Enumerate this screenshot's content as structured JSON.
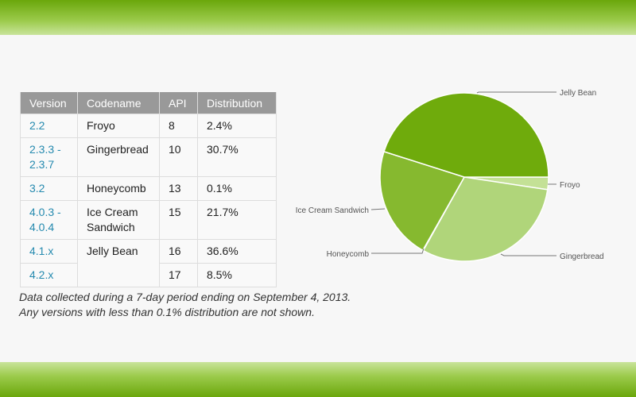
{
  "table": {
    "headers": [
      "Version",
      "Codename",
      "API",
      "Distribution"
    ],
    "rows": [
      {
        "version": "2.2",
        "codename": "Froyo",
        "api": "8",
        "distribution": "2.4%"
      },
      {
        "version": "2.3.3 - 2.3.7",
        "codename": "Gingerbread",
        "api": "10",
        "distribution": "30.7%"
      },
      {
        "version": "3.2",
        "codename": "Honeycomb",
        "api": "13",
        "distribution": "0.1%"
      },
      {
        "version": "4.0.3 - 4.0.4",
        "codename": "Ice Cream Sandwich",
        "api": "15",
        "distribution": "21.7%"
      },
      {
        "version": "4.1.x",
        "codename": "Jelly Bean",
        "api": "16",
        "distribution": "36.6%"
      },
      {
        "version": "4.2.x",
        "codename": "",
        "api": "17",
        "distribution": "8.5%"
      }
    ]
  },
  "caption": {
    "line1": "Data collected during a 7-day period ending on September 4, 2013.",
    "line2": "Any versions with less than 0.1% distribution are not shown."
  },
  "chart_data": {
    "type": "pie",
    "labels": [
      "Froyo",
      "Gingerbread",
      "Honeycomb",
      "Ice Cream Sandwich",
      "Jelly Bean"
    ],
    "values": [
      2.4,
      30.7,
      0.1,
      21.7,
      45.1
    ],
    "colors": [
      "#c4e196",
      "#b0d57a",
      "#9ec95a",
      "#86b92f",
      "#6fab0c"
    ],
    "legend": "leader-line labels"
  },
  "colors": {
    "version_link": "#258aaf",
    "header_bg": "#999999",
    "band": "#8cc13a"
  }
}
